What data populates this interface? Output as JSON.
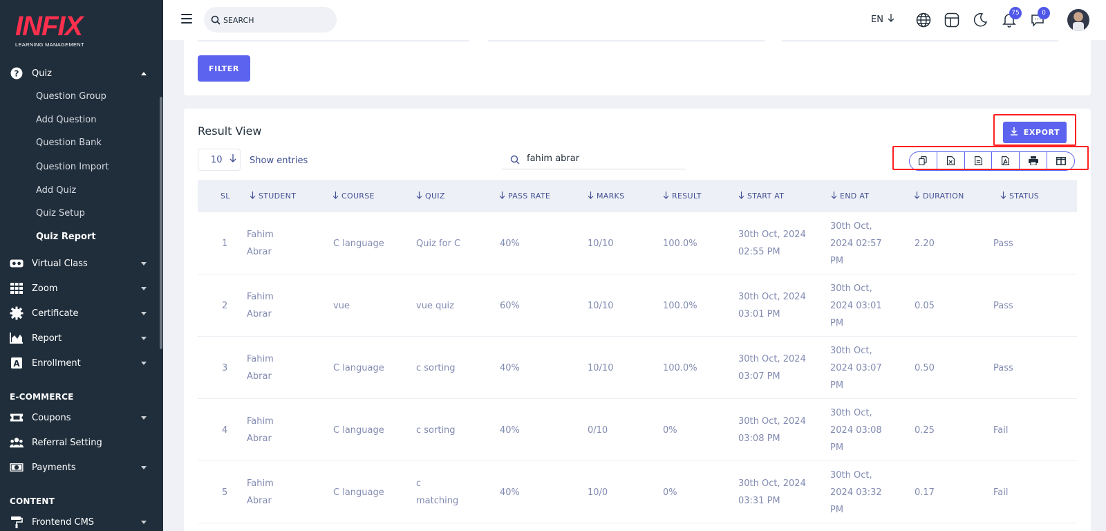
{
  "brand": {
    "logo_text": "INFIX",
    "logo_sub": "LEARNING MANAGEMENT",
    "accent": "#ff2f4d"
  },
  "sidebar": {
    "quiz": {
      "label": "Quiz",
      "icon": "question-circle-icon"
    },
    "quiz_sub": [
      "Question Group",
      "Add Question",
      "Question Bank",
      "Question Import",
      "Add Quiz",
      "Quiz Setup",
      "Quiz Report"
    ],
    "active_sub": "Quiz Report",
    "items": [
      {
        "label": "Virtual Class",
        "icon": "vr-headset-icon"
      },
      {
        "label": "Zoom",
        "icon": "grid-icon"
      },
      {
        "label": "Certificate",
        "icon": "cog-badge-icon"
      },
      {
        "label": "Report",
        "icon": "area-chart-icon"
      },
      {
        "label": "Enrollment",
        "icon": "letter-a-icon"
      }
    ],
    "ecommerce_title": "E-COMMERCE",
    "ecommerce": [
      {
        "label": "Coupons",
        "icon": "coupon-icon"
      },
      {
        "label": "Referral Setting",
        "icon": "users-icon"
      },
      {
        "label": "Payments",
        "icon": "money-icon"
      }
    ],
    "content_title": "CONTENT",
    "content": [
      {
        "label": "Frontend CMS",
        "icon": "paint-roller-icon"
      }
    ]
  },
  "header": {
    "search_placeholder": "SEARCH",
    "language": "EN",
    "notifications_count": "75",
    "messages_count": "0"
  },
  "filter": {
    "button_label": "FILTER"
  },
  "result": {
    "title": "Result View",
    "export_label": "EXPORT",
    "entries_value": "10",
    "entries_label": "Show entries",
    "search_value": "fahim abrar",
    "columns": [
      "SL",
      "STUDENT",
      "COURSE",
      "QUIZ",
      "PASS RATE",
      "MARKS",
      "RESULT",
      "START AT",
      "END AT",
      "DURATION",
      "STATUS"
    ],
    "rows": [
      {
        "sl": "1",
        "student": "Fahim Abrar",
        "course": "C language",
        "quiz": "Quiz for C",
        "pass_rate": "40%",
        "marks": "10/10",
        "result": "100.0%",
        "start_at": "30th Oct, 2024 02:55 PM",
        "end_at": "30th Oct, 2024 02:57 PM",
        "duration": "2.20",
        "status": "Pass"
      },
      {
        "sl": "2",
        "student": "Fahim Abrar",
        "course": "vue",
        "quiz": "vue quiz",
        "pass_rate": "60%",
        "marks": "10/10",
        "result": "100.0%",
        "start_at": "30th Oct, 2024 03:01 PM",
        "end_at": "30th Oct, 2024 03:01 PM",
        "duration": "0.05",
        "status": "Pass"
      },
      {
        "sl": "3",
        "student": "Fahim Abrar",
        "course": "C language",
        "quiz": "c sorting",
        "pass_rate": "40%",
        "marks": "10/10",
        "result": "100.0%",
        "start_at": "30th Oct, 2024 03:07 PM",
        "end_at": "30th Oct, 2024 03:07 PM",
        "duration": "0.50",
        "status": "Pass"
      },
      {
        "sl": "4",
        "student": "Fahim Abrar",
        "course": "C language",
        "quiz": "c sorting",
        "pass_rate": "40%",
        "marks": "0/10",
        "result": "0%",
        "start_at": "30th Oct, 2024 03:08 PM",
        "end_at": "30th Oct, 2024 03:08 PM",
        "duration": "0.25",
        "status": "Fail"
      },
      {
        "sl": "5",
        "student": "Fahim Abrar",
        "course": "C language",
        "quiz": "c matching",
        "pass_rate": "40%",
        "marks": "10/0",
        "result": "0%",
        "start_at": "30th Oct, 2024 03:31 PM",
        "end_at": "30th Oct, 2024 03:32 PM",
        "duration": "0.17",
        "status": "Fail"
      }
    ]
  },
  "colors": {
    "primary": "#5c63ee",
    "sidebar_bg": "#202e3b",
    "highlight": "#ff1f1f"
  }
}
